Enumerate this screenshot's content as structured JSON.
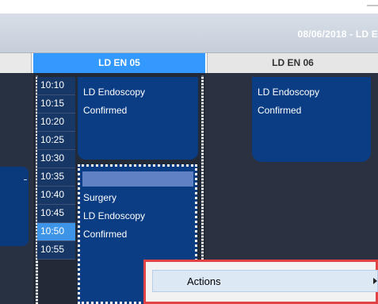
{
  "header": {
    "date_title": "08/06/2018 - LD E"
  },
  "columns": [
    {
      "label": ""
    },
    {
      "label": "LD EN 05"
    },
    {
      "label": "LD EN 06"
    }
  ],
  "time_slots": [
    "10:10",
    "10:15",
    "10:20",
    "10:25",
    "10:30",
    "10:35",
    "10:40",
    "10:45",
    "10:50",
    "10:55"
  ],
  "selected_time": "10:50",
  "appointments": {
    "en05_first": [
      "LD Endoscopy",
      "Confirmed"
    ],
    "en06_first": [
      "LD Endoscopy",
      "Confirmed"
    ],
    "en05_second": [
      "\\",
      "Surgery",
      "LD Endoscopy",
      "Confirmed"
    ]
  },
  "context_menu": {
    "items": [
      {
        "label": "Actions"
      }
    ]
  },
  "colors": {
    "selected_header": "#3399ff",
    "appointment": "#0b3d84",
    "menu_highlight_border": "#e14344"
  }
}
